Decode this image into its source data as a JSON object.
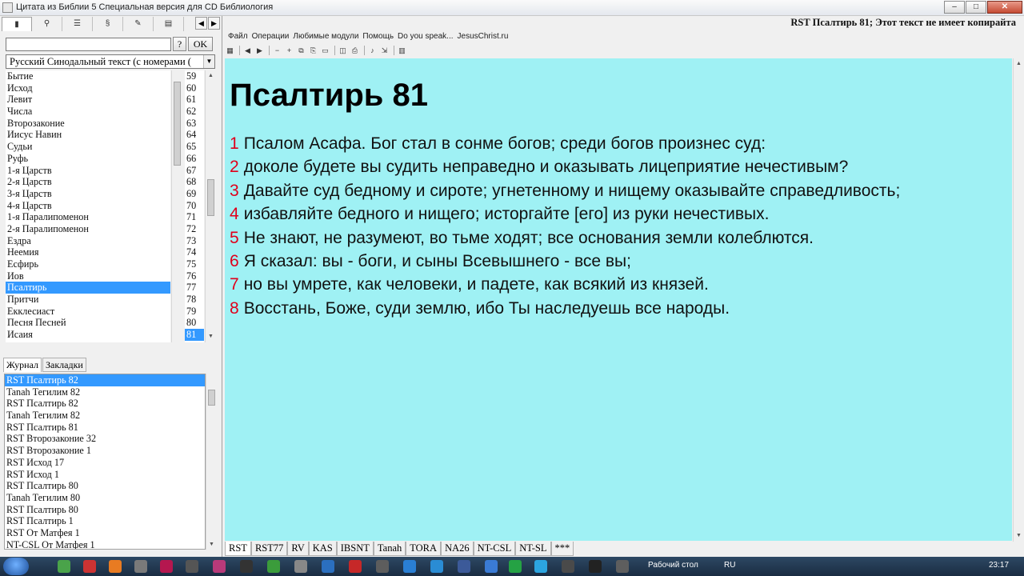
{
  "window": {
    "title": "Цитата из Библии 5 Специальная версия для CD Библиология"
  },
  "left": {
    "search_value": "",
    "question_label": "?",
    "ok_label": "OK",
    "module_select": "Русский Синодальный текст (с номерами (",
    "books": [
      "Бытие",
      "Исход",
      "Левит",
      "Числа",
      "Второзаконие",
      "Иисус Навин",
      "Судьи",
      "Руфь",
      "1-я Царств",
      "2-я Царств",
      "3-я Царств",
      "4-я Царств",
      "1-я Паралипоменон",
      "2-я Паралипоменон",
      "Ездра",
      "Неемия",
      "Есфирь",
      "Иов",
      "Псалтирь",
      "Притчи",
      "Екклесиаст",
      "Песня Песней",
      "Исаия"
    ],
    "selected_book": "Псалтирь",
    "chapters": [
      "59",
      "60",
      "61",
      "62",
      "63",
      "64",
      "65",
      "66",
      "67",
      "68",
      "69",
      "70",
      "71",
      "72",
      "73",
      "74",
      "75",
      "76",
      "77",
      "78",
      "79",
      "80",
      "81"
    ],
    "selected_chapter": "81",
    "bottom_tabs": [
      "Журнал",
      "Закладки"
    ],
    "journal": [
      "RST Псалтирь 82",
      "Tanah Тегилим 82",
      "RST Псалтирь 82",
      "Tanah Тегилим 82",
      "RST Псалтирь 81",
      "RST Второзаконие 32",
      "RST Второзаконие 1",
      "RST Исход 17",
      "RST Исход 1",
      "RST Псалтирь 80",
      "Tanah Тегилим 80",
      "RST Псалтирь 80",
      "RST Псалтирь 1",
      "RST От Матфея 1",
      "NT-CSL От Матфея 1"
    ]
  },
  "right": {
    "reference": "RST Псалтирь 81; Этот текст не имеет копирайта",
    "menu": [
      "Файл",
      "Операции",
      "Любимые модули",
      "Помощь",
      "Do you speak...",
      "JesusChrist.ru"
    ],
    "heading": "Псалтирь 81",
    "verses": [
      {
        "n": "1",
        "text": "Псалом Асафа. Бог стал в сонме богов; среди богов произнес суд:"
      },
      {
        "n": "2",
        "text": "доколе будете вы судить неправедно и оказывать лицеприятие нечестивым?"
      },
      {
        "n": "3",
        "text": "Давайте суд бедному и сироте; угнетенному и нищему оказывайте справедливость;"
      },
      {
        "n": "4",
        "text": "избавляйте бедного и нищего; исторгайте [его] из руки нечестивых."
      },
      {
        "n": "5",
        "text": "Не знают, не разумеют, во тьме ходят; все основания земли колеблются."
      },
      {
        "n": "6",
        "text": "Я сказал: вы - боги, и сыны Всевышнего - все вы;"
      },
      {
        "n": "7",
        "text": "но вы умрете, как человеки, и падете, как всякий из князей."
      },
      {
        "n": "8",
        "text": "Восстань, Боже, суди землю, ибо Ты наследуешь все народы."
      }
    ],
    "module_tabs": [
      "RST",
      "RST77",
      "RV",
      "KAS",
      "IBSNT",
      "Tanah",
      "TORA",
      "NA26",
      "NT-CSL",
      "NT-SL",
      "***"
    ],
    "active_module": "RST"
  },
  "taskbar": {
    "desktop_label": "Рабочий стол",
    "lang": "RU",
    "time": "23:17"
  },
  "colors": {
    "content_bg": "#9ff1f4",
    "verse_number": "#e0001b",
    "selection": "#3399ff"
  }
}
